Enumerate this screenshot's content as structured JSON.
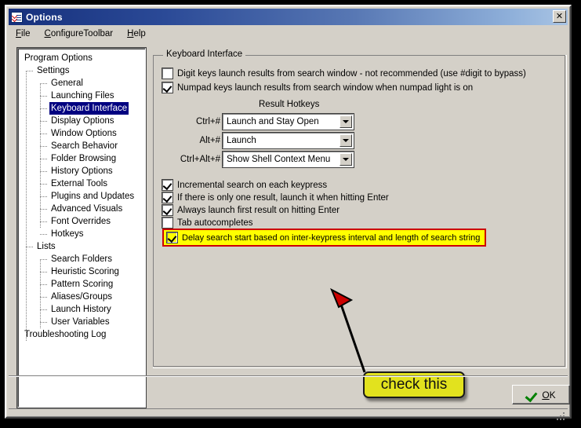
{
  "window": {
    "title": "Options",
    "icon": "options-checklist-icon",
    "close_label": "✕"
  },
  "menubar": {
    "items": [
      {
        "name": "file",
        "accel": "F",
        "rest": "ile"
      },
      {
        "name": "configure-toolbar",
        "accel": "C",
        "rest": "onfigureToolbar"
      },
      {
        "name": "help",
        "accel": "H",
        "rest": "elp"
      }
    ]
  },
  "tree": {
    "nodes": [
      {
        "label": "Program Options",
        "level": 0,
        "selected": false
      },
      {
        "label": "Settings",
        "level": 1,
        "selected": false
      },
      {
        "label": "General",
        "level": 2,
        "selected": false
      },
      {
        "label": "Launching Files",
        "level": 2,
        "selected": false
      },
      {
        "label": "Keyboard Interface",
        "level": 2,
        "selected": true
      },
      {
        "label": "Display Options",
        "level": 2,
        "selected": false
      },
      {
        "label": "Window Options",
        "level": 2,
        "selected": false
      },
      {
        "label": "Search Behavior",
        "level": 2,
        "selected": false
      },
      {
        "label": "Folder Browsing",
        "level": 2,
        "selected": false
      },
      {
        "label": "History Options",
        "level": 2,
        "selected": false
      },
      {
        "label": "External Tools",
        "level": 2,
        "selected": false
      },
      {
        "label": "Plugins and Updates",
        "level": 2,
        "selected": false
      },
      {
        "label": "Advanced Visuals",
        "level": 2,
        "selected": false
      },
      {
        "label": "Font Overrides",
        "level": 2,
        "selected": false
      },
      {
        "label": "Hotkeys",
        "level": 2,
        "selected": false
      },
      {
        "label": "Lists",
        "level": 1,
        "selected": false
      },
      {
        "label": "Search Folders",
        "level": 2,
        "selected": false
      },
      {
        "label": "Heuristic Scoring",
        "level": 2,
        "selected": false
      },
      {
        "label": "Pattern Scoring",
        "level": 2,
        "selected": false
      },
      {
        "label": "Aliases/Groups",
        "level": 2,
        "selected": false
      },
      {
        "label": "Launch History",
        "level": 2,
        "selected": false
      },
      {
        "label": "User Variables",
        "level": 2,
        "selected": false
      },
      {
        "label": "Troubleshooting Log",
        "level": 0,
        "selected": false
      }
    ]
  },
  "groupbox": {
    "title": "Keyboard Interface",
    "top_checkboxes": [
      {
        "label": "Digit keys launch results from search window  - not recommended (use #digit to bypass)",
        "checked": false
      },
      {
        "label": "Numpad keys launch results from search window when numpad light is on",
        "checked": true
      }
    ],
    "hotkeys_section_label": "Result Hotkeys",
    "hotkeys": [
      {
        "label": "Ctrl+#",
        "value": "Launch and Stay Open"
      },
      {
        "label": "Alt+#",
        "value": "Launch"
      },
      {
        "label": "Ctrl+Alt+#",
        "value": "Show Shell Context Menu"
      }
    ],
    "bottom_checkboxes": [
      {
        "label": "Incremental search on each keypress",
        "checked": true
      },
      {
        "label": "If there is only one result, launch it when hitting Enter",
        "checked": true
      },
      {
        "label": "Always launch first result on hitting Enter",
        "checked": true
      },
      {
        "label": "Tab autocompletes",
        "checked": false
      }
    ],
    "highlighted_checkbox": {
      "label": "Delay search start based on inter-keypress interval and length of search string",
      "checked": true,
      "highlight_fill": "#ffff00",
      "highlight_border": "#cc0000"
    }
  },
  "annotation": {
    "callout_text": "check this",
    "callout_fill": "#e2e21e",
    "arrow_head_color": "#cc0000",
    "arrow_line_color": "#000000"
  },
  "footer": {
    "ok_accel": "O",
    "ok_rest": "K",
    "ok_icon": "green-check-icon"
  },
  "colors": {
    "window_face": "#d4d0c8",
    "title_start": "#16307c",
    "title_end": "#a9c4e4",
    "selection": "#000080"
  }
}
